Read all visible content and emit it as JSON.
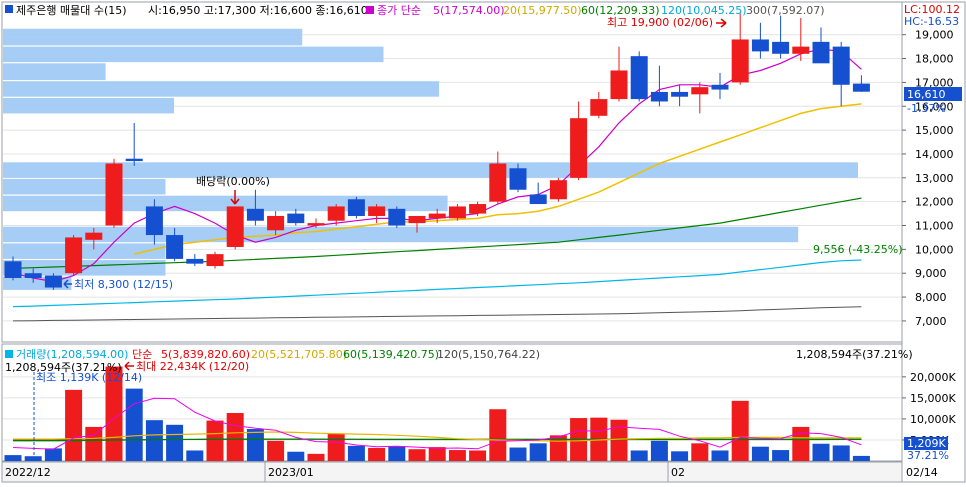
{
  "header": {
    "title": "제주은행 매물대 수(15)",
    "ohlc": "시:16,950 고:17,300 저:16,600 종:16,610",
    "ma_label": "종가 단순",
    "ma_items": [
      {
        "text": "5(17,574.00)",
        "color": "#cc00cc"
      },
      {
        "text": "20(15,977.50)",
        "color": "#e6b800"
      },
      {
        "text": "60(12,209.33)",
        "color": "#008000"
      },
      {
        "text": "120(10,045.25)",
        "color": "#00b7e6"
      },
      {
        "text": "300(7,592.07)",
        "color": "#555555"
      }
    ],
    "lc": "LC:100.12",
    "hc": "HC:-16.53"
  },
  "annotations": {
    "high": "최고 19,900 (02/06)",
    "low": "최저 8,300 (12/15)",
    "dividend": "배당락(0.00%)",
    "ma120_marker": "9,556 (-43.25%)"
  },
  "price_box": {
    "value": "16,610",
    "pct": "-1.37%"
  },
  "volume_header": {
    "volume": "거래량(1,208,594.00)",
    "ma_label": "단순",
    "ma_items": [
      {
        "text": "5(3,839,820.60)",
        "color": "#ee0000"
      },
      {
        "text": "20(5,521,705.80)",
        "color": "#e6b800"
      },
      {
        "text": "60(5,139,420.75)",
        "color": "#008000"
      },
      {
        "text": "120(5,150,764.22)",
        "color": "#444444"
      }
    ],
    "right_label": "1,208,594주(37.21%)",
    "left_label": "1,208,594주(37.21%)",
    "max_label": "최대 22,434K (12/20)",
    "min_label": "최조 1,139K (12/14)",
    "vol_box": "1,209K",
    "vol_pct": "37.21%"
  },
  "x_labels": [
    "2022/12",
    "2023/01",
    "02",
    "02/14"
  ],
  "colors": {
    "up": "#ee1c1c",
    "down": "#1550d0",
    "profile": "#9cc8f5",
    "ma5": "#cc00cc",
    "ma20": "#f0c000",
    "ma60": "#008000",
    "ma120": "#00b7e6",
    "ma300": "#555555",
    "vol_ma5": "#ee00ee",
    "vol_ma20": "#e6b800",
    "vol_ma60": "#008000",
    "vol_ma120": "#444444"
  },
  "chart_data": {
    "type": "candlestick",
    "y_axis_price": {
      "min": 6200,
      "max": 19700,
      "ticks": [
        7000,
        8000,
        9000,
        10000,
        11000,
        12000,
        13000,
        14000,
        15000,
        16000,
        17000,
        18000,
        19000
      ]
    },
    "y_axis_volume": {
      "min": 0,
      "max": 24000,
      "ticks": [
        5000,
        10000,
        15000,
        20000
      ],
      "tick_labels": [
        "5,000K",
        "10,000K",
        "15,000K",
        "20,000K"
      ]
    },
    "candles": [
      {
        "o": 9500,
        "h": 9700,
        "l": 8700,
        "c": 8800,
        "v": 1400
      },
      {
        "o": 9000,
        "h": 9200,
        "l": 8600,
        "c": 8800,
        "v": 1139
      },
      {
        "o": 8900,
        "h": 9000,
        "l": 8300,
        "c": 8400,
        "v": 3000
      },
      {
        "o": 9000,
        "h": 10600,
        "l": 8900,
        "c": 10500,
        "v": 16900
      },
      {
        "o": 10400,
        "h": 10900,
        "l": 10000,
        "c": 10700,
        "v": 8100
      },
      {
        "o": 11000,
        "h": 13800,
        "l": 10900,
        "c": 13600,
        "v": 22434
      },
      {
        "o": 13800,
        "h": 15300,
        "l": 13500,
        "c": 13700,
        "v": 17200
      },
      {
        "o": 11800,
        "h": 12100,
        "l": 10200,
        "c": 10600,
        "v": 9700
      },
      {
        "o": 10600,
        "h": 10900,
        "l": 9500,
        "c": 9600,
        "v": 8600
      },
      {
        "o": 9600,
        "h": 9800,
        "l": 9300,
        "c": 9400,
        "v": 2500
      },
      {
        "o": 9300,
        "h": 9900,
        "l": 9200,
        "c": 9800,
        "v": 9600
      },
      {
        "o": 10100,
        "h": 11800,
        "l": 10000,
        "c": 11800,
        "v": 11400
      },
      {
        "o": 11700,
        "h": 12500,
        "l": 11000,
        "c": 11200,
        "v": 7600
      },
      {
        "o": 10800,
        "h": 11600,
        "l": 10600,
        "c": 11400,
        "v": 4800
      },
      {
        "o": 11500,
        "h": 11700,
        "l": 11000,
        "c": 11100,
        "v": 2200
      },
      {
        "o": 11000,
        "h": 11300,
        "l": 10900,
        "c": 11100,
        "v": 1700
      },
      {
        "o": 11200,
        "h": 11900,
        "l": 11000,
        "c": 11800,
        "v": 6400
      },
      {
        "o": 12100,
        "h": 12200,
        "l": 11300,
        "c": 11400,
        "v": 3600
      },
      {
        "o": 11400,
        "h": 11900,
        "l": 11100,
        "c": 11800,
        "v": 3100
      },
      {
        "o": 11700,
        "h": 11800,
        "l": 10900,
        "c": 11000,
        "v": 3500
      },
      {
        "o": 11100,
        "h": 11400,
        "l": 10700,
        "c": 11400,
        "v": 2800
      },
      {
        "o": 11300,
        "h": 11700,
        "l": 11100,
        "c": 11500,
        "v": 3300
      },
      {
        "o": 11300,
        "h": 11900,
        "l": 11200,
        "c": 11800,
        "v": 2600
      },
      {
        "o": 11500,
        "h": 12000,
        "l": 11400,
        "c": 11900,
        "v": 2500
      },
      {
        "o": 12000,
        "h": 14100,
        "l": 11900,
        "c": 13600,
        "v": 12300
      },
      {
        "o": 13400,
        "h": 13600,
        "l": 12400,
        "c": 12500,
        "v": 3200
      },
      {
        "o": 12300,
        "h": 12800,
        "l": 11900,
        "c": 11900,
        "v": 4200
      },
      {
        "o": 12100,
        "h": 13000,
        "l": 12000,
        "c": 12900,
        "v": 6100
      },
      {
        "o": 13000,
        "h": 16200,
        "l": 12900,
        "c": 15500,
        "v": 10200
      },
      {
        "o": 15600,
        "h": 16600,
        "l": 15500,
        "c": 16300,
        "v": 10300
      },
      {
        "o": 16300,
        "h": 18500,
        "l": 16200,
        "c": 17500,
        "v": 9800
      },
      {
        "o": 18100,
        "h": 18300,
        "l": 16200,
        "c": 16300,
        "v": 2500
      },
      {
        "o": 16600,
        "h": 17700,
        "l": 16000,
        "c": 16200,
        "v": 4800
      },
      {
        "o": 16600,
        "h": 16900,
        "l": 16000,
        "c": 16400,
        "v": 2300
      },
      {
        "o": 16500,
        "h": 17000,
        "l": 15700,
        "c": 16800,
        "v": 4200
      },
      {
        "o": 16900,
        "h": 17400,
        "l": 16300,
        "c": 16700,
        "v": 2500
      },
      {
        "o": 17000,
        "h": 19900,
        "l": 16900,
        "c": 18800,
        "v": 14300
      },
      {
        "o": 18800,
        "h": 19500,
        "l": 18000,
        "c": 18300,
        "v": 3400
      },
      {
        "o": 18700,
        "h": 19800,
        "l": 18000,
        "c": 18200,
        "v": 2600
      },
      {
        "o": 18200,
        "h": 19700,
        "l": 17900,
        "c": 18500,
        "v": 8100
      },
      {
        "o": 18700,
        "h": 19300,
        "l": 17900,
        "c": 17800,
        "v": 4100
      },
      {
        "o": 18500,
        "h": 18700,
        "l": 16000,
        "c": 16900,
        "v": 3700
      },
      {
        "o": 16950,
        "h": 17300,
        "l": 16600,
        "c": 16610,
        "v": 1209
      }
    ],
    "ma5": [
      9000,
      8800,
      8650,
      8900,
      9400,
      10300,
      11100,
      11500,
      11800,
      11500,
      11100,
      10600,
      10300,
      10500,
      10800,
      11000,
      11100,
      11200,
      11300,
      11300,
      11200,
      11300,
      11400,
      11500,
      11900,
      12200,
      12300,
      12700,
      13500,
      14300,
      15300,
      16100,
      16700,
      16900,
      16900,
      16800,
      17300,
      17500,
      17800,
      18200,
      18400,
      18300,
      17550
    ],
    "ma20": [
      null,
      null,
      null,
      null,
      null,
      null,
      9800,
      10000,
      10200,
      10300,
      10400,
      10500,
      10550,
      10600,
      10700,
      10750,
      10850,
      10950,
      11050,
      11150,
      11150,
      11200,
      11250,
      11300,
      11450,
      11500,
      11600,
      11800,
      12100,
      12400,
      12800,
      13200,
      13600,
      13900,
      14200,
      14500,
      14800,
      15100,
      15400,
      15700,
      15900,
      16000,
      16100
    ],
    "ma60": [
      9200,
      9230,
      9260,
      9290,
      9320,
      9350,
      9380,
      9410,
      9440,
      9470,
      9500,
      9540,
      9580,
      9620,
      9660,
      9700,
      9750,
      9800,
      9850,
      9900,
      9950,
      10000,
      10050,
      10100,
      10150,
      10200,
      10250,
      10300,
      10400,
      10500,
      10600,
      10700,
      10800,
      10900,
      11000,
      11100,
      11250,
      11400,
      11550,
      11700,
      11850,
      12000,
      12150
    ],
    "ma120": [
      7600,
      7620,
      7650,
      7680,
      7710,
      7740,
      7770,
      7800,
      7830,
      7860,
      7890,
      7920,
      7960,
      8000,
      8040,
      8080,
      8120,
      8160,
      8200,
      8240,
      8280,
      8320,
      8360,
      8400,
      8440,
      8480,
      8520,
      8560,
      8600,
      8650,
      8700,
      8750,
      8800,
      8850,
      8900,
      8950,
      9050,
      9150,
      9250,
      9350,
      9450,
      9520,
      9556
    ],
    "ma300": [
      7000,
      7010,
      7020,
      7030,
      7040,
      7050,
      7060,
      7070,
      7080,
      7090,
      7100,
      7110,
      7120,
      7130,
      7140,
      7150,
      7160,
      7170,
      7180,
      7190,
      7200,
      7210,
      7220,
      7230,
      7240,
      7250,
      7260,
      7270,
      7280,
      7290,
      7300,
      7320,
      7340,
      7360,
      7380,
      7400,
      7430,
      7460,
      7490,
      7520,
      7550,
      7570,
      7592
    ],
    "vol_ma5": [
      3200,
      3000,
      2800,
      5500,
      6100,
      10100,
      13600,
      14900,
      14800,
      11600,
      9500,
      8400,
      7800,
      7300,
      5600,
      4600,
      4500,
      3800,
      3400,
      3500,
      3300,
      3000,
      3100,
      2900,
      4700,
      4800,
      5000,
      5700,
      7200,
      7100,
      8100,
      7800,
      7500,
      5900,
      4800,
      3300,
      5600,
      5400,
      5300,
      6700,
      6500,
      5600,
      3840
    ],
    "vol_ma20": [
      5200,
      5200,
      5200,
      5300,
      5400,
      5600,
      6000,
      6200,
      6300,
      6400,
      6500,
      6700,
      6800,
      6900,
      6800,
      6600,
      6500,
      6400,
      6300,
      6100,
      5900,
      5600,
      5300,
      5100,
      5000,
      4900,
      4800,
      4700,
      4800,
      5000,
      5200,
      5300,
      5400,
      5400,
      5500,
      5500,
      5600,
      5600,
      5600,
      5500,
      5500,
      5500,
      5522
    ],
    "vol_ma60": [
      4800,
      4800,
      4800,
      4850,
      4900,
      4950,
      5000,
      5050,
      5100,
      5150,
      5200,
      5200,
      5200,
      5200,
      5200,
      5200,
      5150,
      5150,
      5100,
      5100,
      5100,
      5100,
      5100,
      5100,
      5100,
      5100,
      5100,
      5100,
      5100,
      5100,
      5100,
      5100,
      5100,
      5100,
      5100,
      5100,
      5100,
      5100,
      5100,
      5100,
      5120,
      5130,
      5139
    ],
    "vol_ma120": [
      5000,
      5000,
      5000,
      5000,
      5020,
      5040,
      5060,
      5080,
      5100,
      5120,
      5140,
      5150,
      5150,
      5150,
      5150,
      5150,
      5150,
      5150,
      5150,
      5150,
      5150,
      5150,
      5150,
      5150,
      5150,
      5150,
      5150,
      5150,
      5150,
      5150,
      5150,
      5150,
      5150,
      5150,
      5150,
      5150,
      5150,
      5150,
      5150,
      5150,
      5150,
      5150,
      5151
    ],
    "volume_profile": [
      {
        "price_low": 18550,
        "price_high": 19250,
        "weight": 0.35
      },
      {
        "price_low": 17850,
        "price_high": 18500,
        "weight": 0.445
      },
      {
        "price_low": 17100,
        "price_high": 17800,
        "weight": 0.12
      },
      {
        "price_low": 16400,
        "price_high": 17050,
        "weight": 0.51
      },
      {
        "price_low": 15700,
        "price_high": 16350,
        "weight": 0.2
      },
      {
        "price_low": 13000,
        "price_high": 13650,
        "weight": 1.0
      },
      {
        "price_low": 12300,
        "price_high": 12950,
        "weight": 0.19
      },
      {
        "price_low": 11600,
        "price_high": 12250,
        "weight": 0.52
      },
      {
        "price_low": 10300,
        "price_high": 10950,
        "weight": 0.93
      },
      {
        "price_low": 9600,
        "price_high": 10250,
        "weight": 0.19
      },
      {
        "price_low": 8900,
        "price_high": 9550,
        "weight": 0.19
      },
      {
        "price_low": 8300,
        "price_high": 8850,
        "weight": 0.08
      }
    ]
  }
}
